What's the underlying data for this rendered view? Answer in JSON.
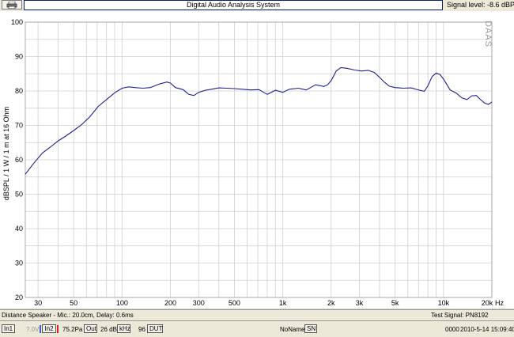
{
  "window": {
    "title": "Digital Audio Analysis System",
    "signal_level": "Signal level: -8.6 dBPa"
  },
  "icons": {
    "print": "printer-icon"
  },
  "watermark": "DAAS",
  "chart_data": {
    "type": "line",
    "title": "",
    "ylabel": "dBSPL / 1 W / 1 m at 16 Ohm",
    "xlabel": "Hz",
    "x_scale": "log",
    "xlim": [
      25,
      20000
    ],
    "ylim": [
      20,
      100
    ],
    "y_ticks": [
      20,
      30,
      40,
      50,
      60,
      70,
      80,
      90,
      100
    ],
    "y_tick_labels": [
      "20",
      "30",
      "40",
      "50",
      "60",
      "70",
      "80",
      "90",
      "100"
    ],
    "x_ticks": [
      30,
      50,
      100,
      200,
      300,
      500,
      1000,
      2000,
      3000,
      5000,
      10000,
      20000
    ],
    "x_tick_labels": [
      "30",
      "50",
      "100",
      "200",
      "300",
      "500",
      "1k",
      "2k",
      "3k",
      "5k",
      "10k",
      "20k"
    ],
    "grid": true,
    "line_color": "#1f1f8f",
    "series": [
      {
        "x": [
          25,
          28,
          32,
          36,
          40,
          45,
          50,
          56,
          63,
          71,
          80,
          90,
          100,
          110,
          120,
          135,
          150,
          170,
          190,
          200,
          215,
          240,
          260,
          280,
          300,
          330,
          360,
          400,
          450,
          500,
          560,
          630,
          710,
          760,
          800,
          900,
          1000,
          1100,
          1250,
          1400,
          1600,
          1800,
          1900,
          2000,
          2150,
          2300,
          2500,
          2800,
          3100,
          3400,
          3700,
          4000,
          4300,
          4600,
          5000,
          5600,
          6300,
          7100,
          7600,
          8000,
          8500,
          9000,
          9500,
          10000,
          11000,
          12000,
          13000,
          14000,
          15000,
          16000,
          17000,
          18000,
          19000,
          20000
        ],
        "y": [
          55.8,
          58.8,
          62.0,
          63.8,
          65.5,
          67.0,
          68.5,
          70.2,
          72.5,
          75.5,
          77.5,
          79.5,
          80.8,
          81.2,
          81.0,
          80.8,
          81.0,
          82.0,
          82.6,
          82.3,
          81.0,
          80.4,
          79.0,
          78.7,
          79.6,
          80.2,
          80.5,
          80.9,
          80.8,
          80.7,
          80.5,
          80.3,
          80.4,
          79.6,
          79.0,
          80.2,
          79.6,
          80.5,
          80.8,
          80.3,
          81.8,
          81.3,
          81.8,
          83.0,
          85.8,
          86.8,
          86.6,
          86.1,
          85.8,
          86.0,
          85.4,
          84.0,
          82.5,
          81.4,
          81.0,
          80.8,
          80.9,
          80.2,
          79.9,
          81.5,
          84.2,
          85.2,
          84.8,
          83.5,
          80.3,
          79.4,
          78.0,
          77.5,
          78.6,
          78.7,
          77.5,
          76.5,
          76.1,
          76.8
        ]
      }
    ]
  },
  "info_bar": {
    "left": "Distance Speaker - Mic.: 20.0cm, Delay: 0.6ms",
    "right": "Test Signal: PN8192"
  },
  "status_bar": {
    "in1": "In1",
    "in1_value": "?.0V",
    "in2": "In2",
    "in2_value": "75.2Pa",
    "out": "Out",
    "out_value": "26 dB",
    "khz": "kHz",
    "khz_value": "96",
    "dut": "DUT",
    "name": "NoName",
    "sn": "SN",
    "counter": "0000",
    "datetime": "2010-5-14  15:09:40"
  }
}
